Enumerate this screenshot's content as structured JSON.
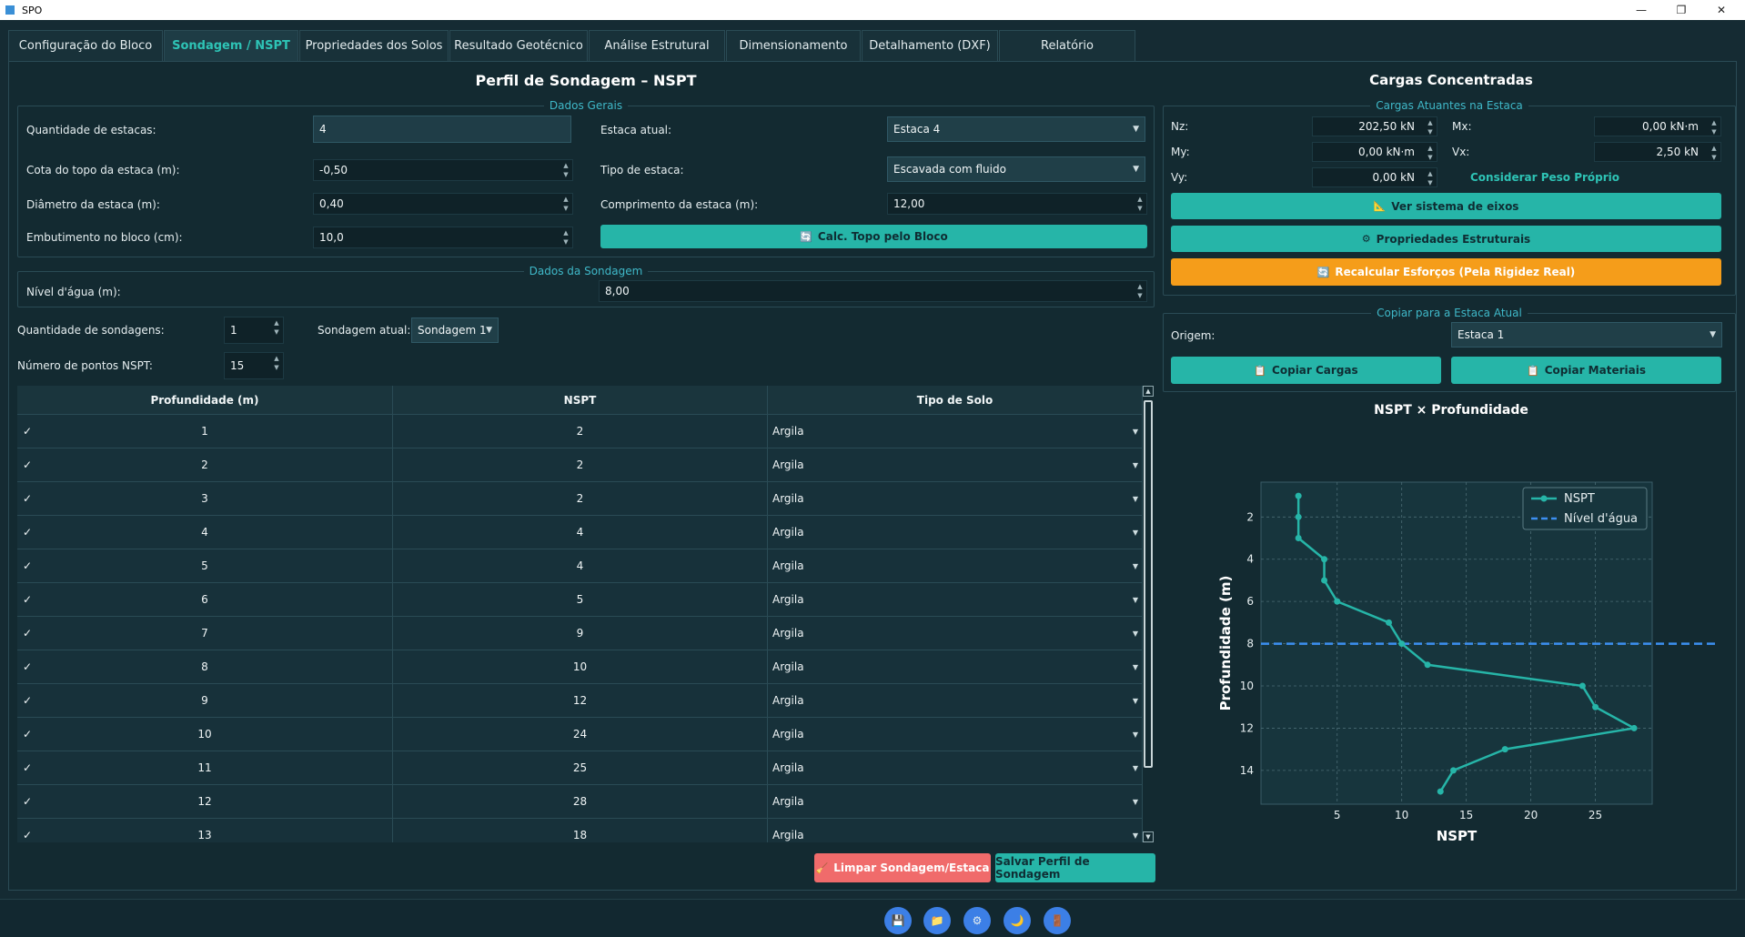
{
  "window": {
    "title": "SPO"
  },
  "tabs": [
    {
      "label": "Configuração do Bloco",
      "active": false
    },
    {
      "label": "Sondagem / NSPT",
      "active": true
    },
    {
      "label": "Propriedades dos Solos",
      "active": false
    },
    {
      "label": "Resultado Geotécnico",
      "active": false
    },
    {
      "label": "Análise Estrutural",
      "active": false
    },
    {
      "label": "Dimensionamento",
      "active": false
    },
    {
      "label": "Detalhamento (DXF)",
      "active": false
    },
    {
      "label": "Relatório",
      "active": false
    }
  ],
  "left": {
    "title": "Perfil de Sondagem – NSPT",
    "dados_gerais": {
      "title": "Dados Gerais",
      "qtd_estacas_label": "Quantidade de estacas:",
      "qtd_estacas": "4",
      "cota_topo_label": "Cota do topo da estaca (m):",
      "cota_topo": "-0,50",
      "diametro_label": "Diâmetro da estaca (m):",
      "diametro": "0,40",
      "embutimento_label": "Embutimento no bloco (cm):",
      "embutimento": "10,0",
      "estaca_atual_label": "Estaca atual:",
      "estaca_atual": "Estaca 4",
      "tipo_estaca_label": "Tipo de estaca:",
      "tipo_estaca": "Escavada com fluido",
      "comprimento_label": "Comprimento da estaca (m):",
      "comprimento": "12,00",
      "calc_topo_button": "Calc. Topo pelo Bloco"
    },
    "dados_sondagem": {
      "title": "Dados da Sondagem",
      "nivel_agua_label": "Nível d'água (m):",
      "nivel_agua": "8,00"
    },
    "qtd_sondagens_label": "Quantidade de sondagens:",
    "qtd_sondagens": "1",
    "sondagem_atual_label": "Sondagem atual:",
    "sondagem_atual": "Sondagem 1",
    "num_pontos_label": "Número de pontos NSPT:",
    "num_pontos": "15",
    "table": {
      "headers": [
        "Profundidade (m)",
        "NSPT",
        "Tipo de Solo"
      ],
      "check_mark": "✓",
      "rows": [
        {
          "depth": "1",
          "nspt": "2",
          "solo": "Argila"
        },
        {
          "depth": "2",
          "nspt": "2",
          "solo": "Argila"
        },
        {
          "depth": "3",
          "nspt": "2",
          "solo": "Argila"
        },
        {
          "depth": "4",
          "nspt": "4",
          "solo": "Argila"
        },
        {
          "depth": "5",
          "nspt": "4",
          "solo": "Argila"
        },
        {
          "depth": "6",
          "nspt": "5",
          "solo": "Argila"
        },
        {
          "depth": "7",
          "nspt": "9",
          "solo": "Argila"
        },
        {
          "depth": "8",
          "nspt": "10",
          "solo": "Argila"
        },
        {
          "depth": "9",
          "nspt": "12",
          "solo": "Argila"
        },
        {
          "depth": "10",
          "nspt": "24",
          "solo": "Argila"
        },
        {
          "depth": "11",
          "nspt": "25",
          "solo": "Argila"
        },
        {
          "depth": "12",
          "nspt": "28",
          "solo": "Argila"
        },
        {
          "depth": "13",
          "nspt": "18",
          "solo": "Argila"
        }
      ]
    },
    "limpar_button": "Limpar Sondagem/Estaca",
    "salvar_button": "Salvar Perfil de Sondagem"
  },
  "right": {
    "title": "Cargas Concentradas",
    "cargas": {
      "title": "Cargas Atuantes na Estaca",
      "nz_label": "Nz:",
      "nz": "202,50 kN",
      "mx_label": "Mx:",
      "mx": "0,00 kN·m",
      "my_label": "My:",
      "my": "0,00 kN·m",
      "vx_label": "Vx:",
      "vx": "2,50 kN",
      "vy_label": "Vy:",
      "vy": "0,00 kN",
      "peso_proprio": "Considerar Peso Próprio",
      "ver_eixos_button": "Ver sistema de eixos",
      "propriedades_button": "Propriedades Estruturais",
      "recalcular_button": "Recalcular Esforços (Pela Rigidez Real)"
    },
    "copiar": {
      "title": "Copiar para a Estaca Atual",
      "origem_label": "Origem:",
      "origem": "Estaca 1",
      "copiar_cargas_button": "Copiar Cargas",
      "copiar_materiais_button": "Copiar Materiais"
    }
  },
  "chart_data": {
    "type": "line",
    "title": "NSPT × Profundidade",
    "xlabel": "NSPT",
    "ylabel": "Profundidade (m)",
    "x_ticks": [
      "5",
      "10",
      "15",
      "20",
      "25"
    ],
    "y_ticks": [
      "2",
      "4",
      "6",
      "8",
      "10",
      "12",
      "14"
    ],
    "xlim": [
      -0.9,
      29.4
    ],
    "ylim": [
      15.6,
      0.35
    ],
    "y_inverted": true,
    "grid": true,
    "legend_position": "top-right",
    "series": [
      {
        "name": "NSPT",
        "color": "#26b5a8",
        "points": [
          [
            2,
            1
          ],
          [
            2,
            2
          ],
          [
            2,
            3
          ],
          [
            4,
            4
          ],
          [
            4,
            5
          ],
          [
            5,
            6
          ],
          [
            9,
            7
          ],
          [
            10,
            8
          ],
          [
            12,
            9
          ],
          [
            24,
            10
          ],
          [
            25,
            11
          ],
          [
            28,
            12
          ],
          [
            18,
            13
          ],
          [
            14,
            14
          ],
          [
            13,
            15
          ]
        ]
      }
    ],
    "water_level": {
      "name": "Nível d'água",
      "y": 8,
      "color": "#3c8ff0"
    }
  },
  "toolbar_icons": [
    {
      "name": "save-icon",
      "glyph": "💾"
    },
    {
      "name": "folder-icon",
      "glyph": "📁"
    },
    {
      "name": "settings-icon",
      "glyph": "⚙"
    },
    {
      "name": "moon-icon",
      "glyph": "🌙"
    },
    {
      "name": "exit-icon",
      "glyph": "🚪"
    }
  ]
}
